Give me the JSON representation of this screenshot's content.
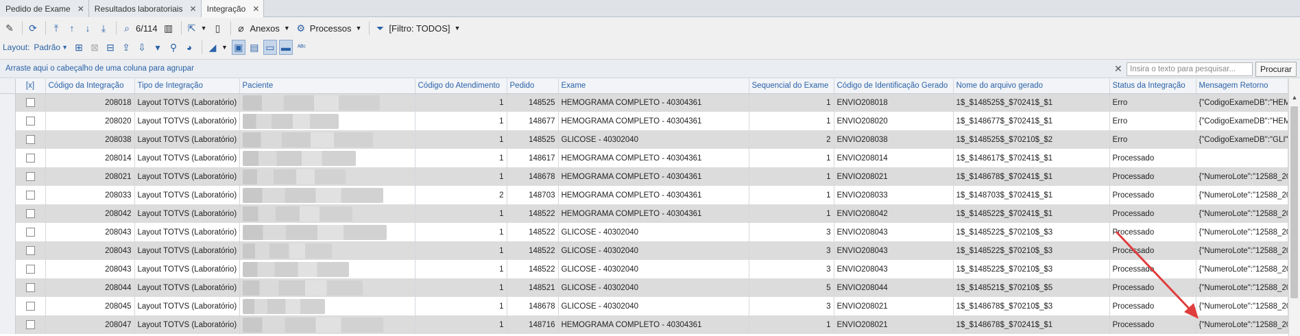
{
  "tabs": [
    {
      "label": "Pedido de Exame",
      "active": false
    },
    {
      "label": "Resultados laboratoriais",
      "active": false
    },
    {
      "label": "Integração",
      "active": true
    }
  ],
  "toolbar": {
    "record_counter": "6/114",
    "anexos_label": "Anexos",
    "processos_label": "Processos",
    "filter_label": "[Filtro: TODOS]",
    "layout_label": "Layout:",
    "layout_value": "Padrão"
  },
  "groupbar": {
    "hint": "Arraste aqui o cabeçalho de uma coluna para agrupar",
    "search_placeholder": "Insira o texto para pesquisar...",
    "search_button": "Procurar"
  },
  "grid": {
    "columns": [
      "[x]",
      "Código da Integração",
      "Tipo de Integração",
      "Paciente",
      "Código do Atendimento",
      "Pedido",
      "Exame",
      "Sequencial do Exame",
      "Código de Identificação Gerado",
      "Nome do arquivo gerado",
      "Status da Integração",
      "Mensagem Retorno"
    ],
    "rows": [
      {
        "codigo": "208018",
        "tipo": "Layout TOTVS (Laboratório)",
        "atend": "1",
        "pedido": "148525",
        "exame": "HEMOGRAMA COMPLETO - 40304361",
        "seq": "1",
        "ident": "ENVIO208018",
        "arquivo": "1$_$148525$_$70241$_$1",
        "status": "Erro",
        "msg": "{\"CodigoExameDB\":\"HEMO"
      },
      {
        "codigo": "208020",
        "tipo": "Layout TOTVS (Laboratório)",
        "atend": "1",
        "pedido": "148677",
        "exame": "HEMOGRAMA COMPLETO - 40304361",
        "seq": "1",
        "ident": "ENVIO208020",
        "arquivo": "1$_$148677$_$70241$_$1",
        "status": "Erro",
        "msg": "{\"CodigoExameDB\":\"HEMO"
      },
      {
        "codigo": "208038",
        "tipo": "Layout TOTVS (Laboratório)",
        "atend": "1",
        "pedido": "148525",
        "exame": "GLICOSE - 40302040",
        "seq": "2",
        "ident": "ENVIO208038",
        "arquivo": "1$_$148525$_$70210$_$2",
        "status": "Erro",
        "msg": "{\"CodigoExameDB\":\"GLI\","
      },
      {
        "codigo": "208014",
        "tipo": "Layout TOTVS (Laboratório)",
        "atend": "1",
        "pedido": "148617",
        "exame": "HEMOGRAMA COMPLETO - 40304361",
        "seq": "1",
        "ident": "ENVIO208014",
        "arquivo": "1$_$148617$_$70241$_$1",
        "status": "Processado",
        "msg": ""
      },
      {
        "codigo": "208021",
        "tipo": "Layout TOTVS (Laboratório)",
        "atend": "1",
        "pedido": "148678",
        "exame": "HEMOGRAMA COMPLETO - 40304361",
        "seq": "1",
        "ident": "ENVIO208021",
        "arquivo": "1$_$148678$_$70241$_$1",
        "status": "Processado",
        "msg": "{\"NumeroLote\":\"12588_20"
      },
      {
        "codigo": "208033",
        "tipo": "Layout TOTVS (Laboratório)",
        "atend": "2",
        "pedido": "148703",
        "exame": "HEMOGRAMA COMPLETO - 40304361",
        "seq": "1",
        "ident": "ENVIO208033",
        "arquivo": "1$_$148703$_$70241$_$1",
        "status": "Processado",
        "msg": "{\"NumeroLote\":\"12588_20"
      },
      {
        "codigo": "208042",
        "tipo": "Layout TOTVS (Laboratório)",
        "atend": "1",
        "pedido": "148522",
        "exame": "HEMOGRAMA COMPLETO - 40304361",
        "seq": "1",
        "ident": "ENVIO208042",
        "arquivo": "1$_$148522$_$70241$_$1",
        "status": "Processado",
        "msg": "{\"NumeroLote\":\"12588_20"
      },
      {
        "codigo": "208043",
        "tipo": "Layout TOTVS (Laboratório)",
        "atend": "1",
        "pedido": "148522",
        "exame": "GLICOSE - 40302040",
        "seq": "3",
        "ident": "ENVIO208043",
        "arquivo": "1$_$148522$_$70210$_$3",
        "status": "Processado",
        "msg": "{\"NumeroLote\":\"12588_20"
      },
      {
        "codigo": "208043",
        "tipo": "Layout TOTVS (Laboratório)",
        "atend": "1",
        "pedido": "148522",
        "exame": "GLICOSE - 40302040",
        "seq": "3",
        "ident": "ENVIO208043",
        "arquivo": "1$_$148522$_$70210$_$3",
        "status": "Processado",
        "msg": "{\"NumeroLote\":\"12588_20"
      },
      {
        "codigo": "208043",
        "tipo": "Layout TOTVS (Laboratório)",
        "atend": "1",
        "pedido": "148522",
        "exame": "GLICOSE - 40302040",
        "seq": "3",
        "ident": "ENVIO208043",
        "arquivo": "1$_$148522$_$70210$_$3",
        "status": "Processado",
        "msg": "{\"NumeroLote\":\"12588_20"
      },
      {
        "codigo": "208044",
        "tipo": "Layout TOTVS (Laboratório)",
        "atend": "1",
        "pedido": "148521",
        "exame": "GLICOSE - 40302040",
        "seq": "5",
        "ident": "ENVIO208044",
        "arquivo": "1$_$148521$_$70210$_$5",
        "status": "Processado",
        "msg": "{\"NumeroLote\":\"12588_20"
      },
      {
        "codigo": "208045",
        "tipo": "Layout TOTVS (Laboratório)",
        "atend": "1",
        "pedido": "148678",
        "exame": "GLICOSE - 40302040",
        "seq": "3",
        "ident": "ENVIO208021",
        "arquivo": "1$_$148678$_$70210$_$3",
        "status": "Processado",
        "msg": "{\"NumeroLote\":\"12588_20"
      },
      {
        "codigo": "208047",
        "tipo": "Layout TOTVS (Laboratório)",
        "atend": "1",
        "pedido": "148716",
        "exame": "HEMOGRAMA COMPLETO - 40304361",
        "seq": "1",
        "ident": "ENVIO208021",
        "arquivo": "1$_$148678$_$70241$_$1",
        "status": "Processado",
        "msg": "{\"NumeroLote\":\"12588_20"
      }
    ]
  },
  "colors": {
    "accent": "#2b62a8",
    "annotation_arrow": "#e03c3c"
  }
}
